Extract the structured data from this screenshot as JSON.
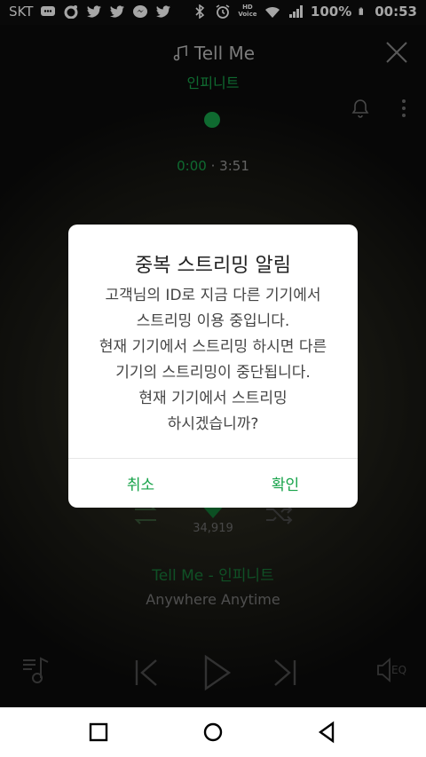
{
  "status_bar": {
    "carrier": "SKT",
    "battery": "100%",
    "time": "00:53",
    "hd_voice": "HD Voice"
  },
  "player": {
    "title": "Tell Me",
    "artist": "인피니트",
    "time_elapsed": "0:00",
    "time_separator": "·",
    "time_total": "3:51",
    "like_count": "34,919",
    "song_line": "Tell Me - 인피니트",
    "album": "Anywhere Anytime",
    "eq_label": "EQ"
  },
  "dialog": {
    "title": "중복 스트리밍 알림",
    "message_lines": [
      "고객님의 ID로 지금 다른 기기에서",
      "스트리밍 이용 중입니다.",
      "현재 기기에서 스트리밍 하시면 다른",
      "기기의 스트리밍이 중단됩니다.",
      "현재 기기에서 스트리밍",
      "하시겠습니까?"
    ],
    "cancel_label": "취소",
    "confirm_label": "확인"
  },
  "colors": {
    "accent": "#17a34a"
  }
}
